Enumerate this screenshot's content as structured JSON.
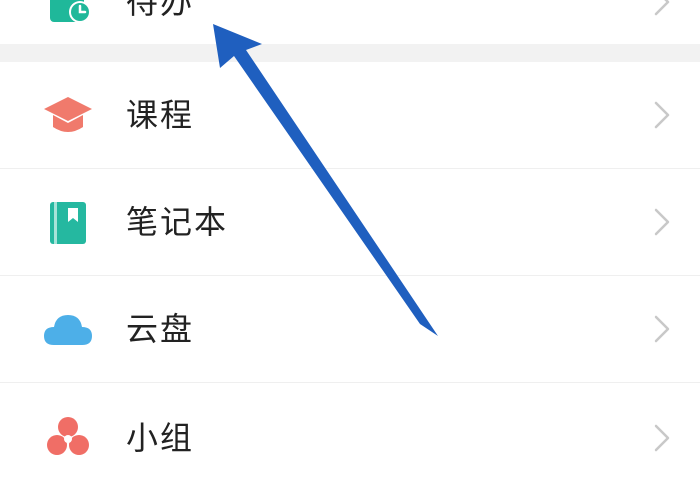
{
  "menu": {
    "items": [
      {
        "label": "待办",
        "icon": "todo-icon",
        "color": "#1fb89a"
      },
      {
        "label": "课程",
        "icon": "graduation-cap-icon",
        "color": "#f07a6c"
      },
      {
        "label": "笔记本",
        "icon": "notebook-icon",
        "color": "#25b8a0"
      },
      {
        "label": "云盘",
        "icon": "cloud-icon",
        "color": "#4dafe8"
      },
      {
        "label": "小组",
        "icon": "group-icon",
        "color": "#f06e66"
      }
    ]
  },
  "annotation": {
    "icon": "blue-arrow-annotation",
    "color": "#1f5fbf"
  },
  "chevron_color": "#c8c8c8"
}
